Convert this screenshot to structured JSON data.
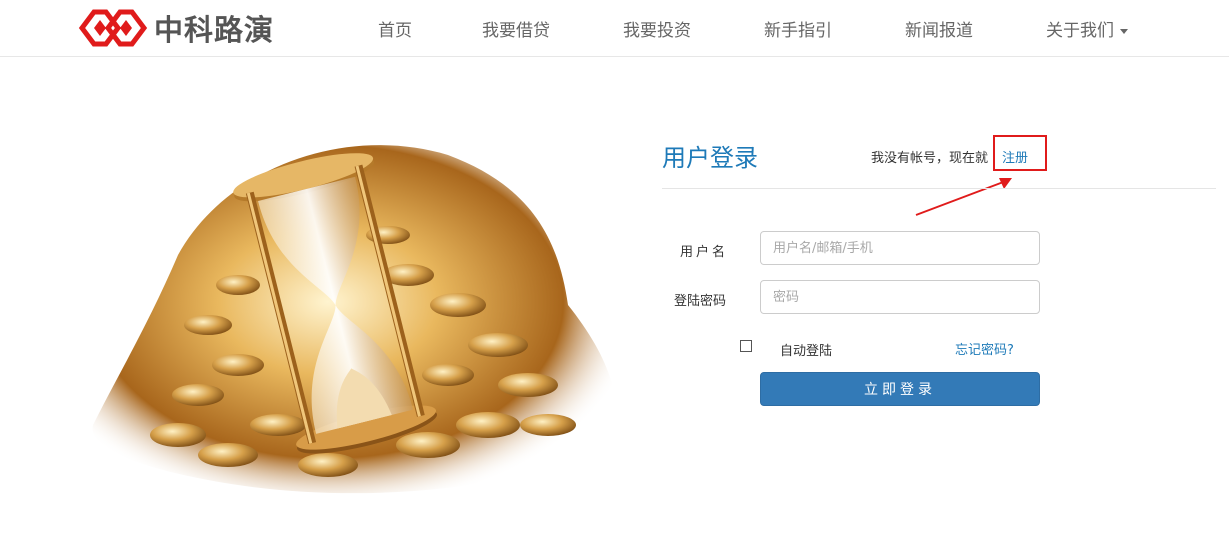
{
  "brand": {
    "name": "中科路演",
    "color": "#e01b1b"
  },
  "nav": {
    "items": [
      {
        "label": "首页"
      },
      {
        "label": "我要借贷"
      },
      {
        "label": "我要投资"
      },
      {
        "label": "新手指引"
      },
      {
        "label": "新闻报道"
      },
      {
        "label": "关于我们"
      }
    ]
  },
  "hero": {
    "icon": "hourglass-coins-image"
  },
  "login": {
    "title": "用户登录",
    "register_prompt": "我没有帐号，现在就",
    "register_link": "注册",
    "username_label": "用户名",
    "username_placeholder": "用户名/邮箱/手机",
    "password_label": "登陆密码",
    "password_placeholder": "密码",
    "auto_login_label": "自动登陆",
    "forgot_label": "忘记密码?",
    "submit_label": "立即登录"
  },
  "colors": {
    "accent": "#1e7ab8",
    "button": "#337ab7",
    "annotation": "#e01b1b"
  }
}
